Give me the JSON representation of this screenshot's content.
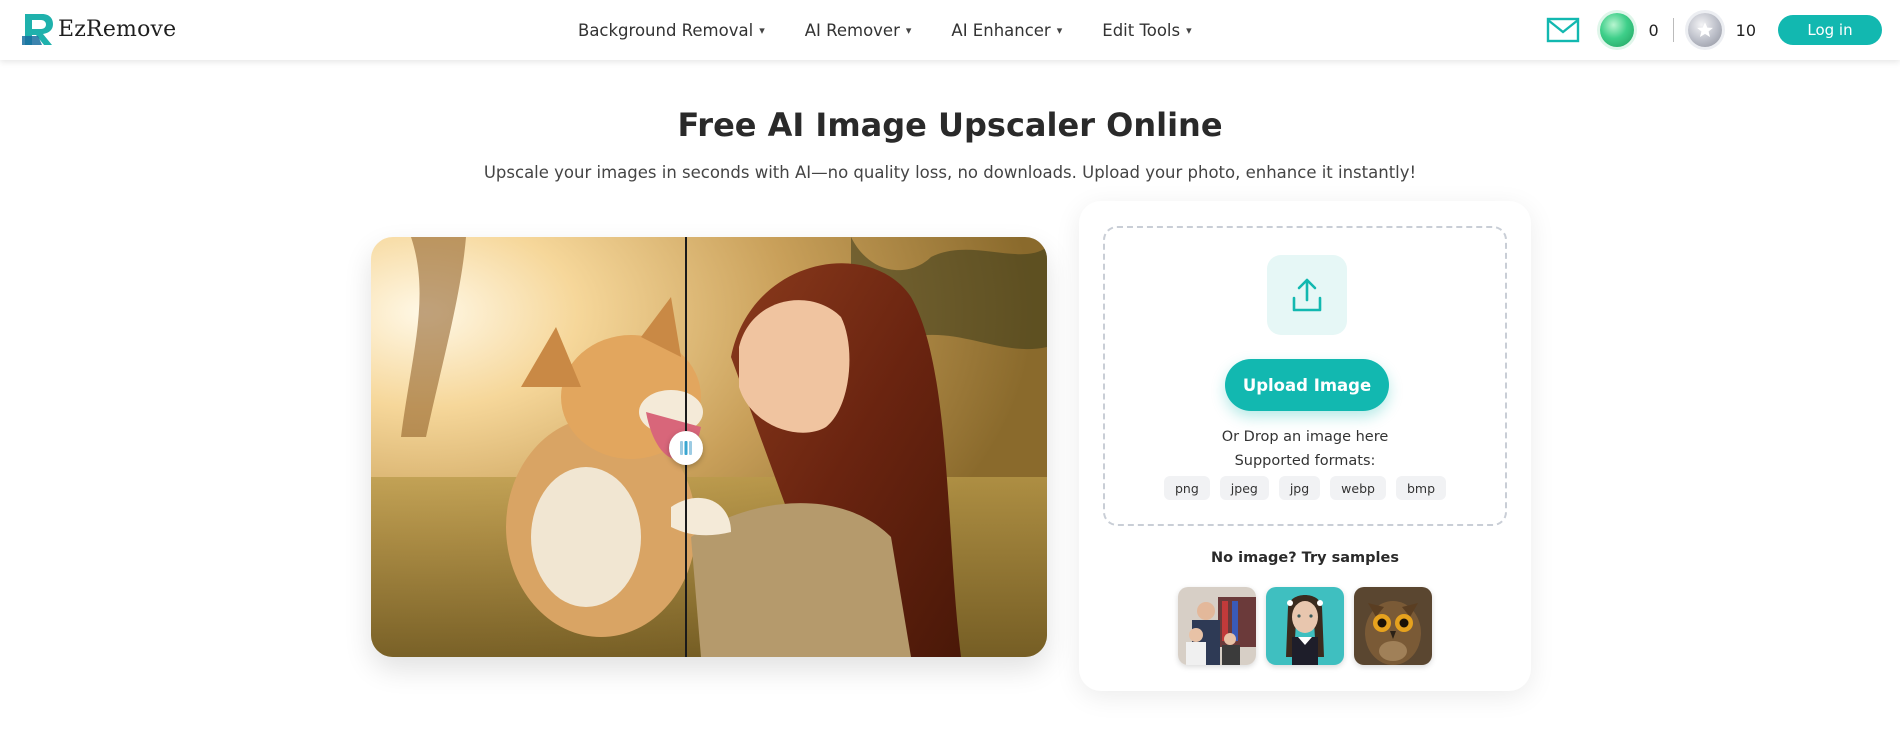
{
  "brand": {
    "name": "EzRemove"
  },
  "nav": {
    "items": [
      {
        "label": "Background Removal"
      },
      {
        "label": "AI Remover"
      },
      {
        "label": "AI Enhancer"
      },
      {
        "label": "Edit Tools"
      }
    ],
    "caret": "▾"
  },
  "account": {
    "green_credits": "0",
    "silver_credits": "10",
    "login_label": "Log in"
  },
  "hero": {
    "title": "Free AI Image Upscaler Online",
    "subtitle": "Upscale your images in seconds with AI—no quality loss, no downloads. Upload your photo, enhance it instantly!"
  },
  "upload": {
    "button_label": "Upload Image",
    "drop_text": "Or Drop an image here",
    "formats_label": "Supported formats:",
    "formats": [
      "png",
      "jpeg",
      "jpg",
      "webp",
      "bmp"
    ]
  },
  "samples": {
    "title": "No image? Try samples",
    "items": [
      {
        "name": "sample-family"
      },
      {
        "name": "sample-girl-braids"
      },
      {
        "name": "sample-owl"
      }
    ]
  },
  "colors": {
    "accent": "#12b8b0",
    "accent_light": "#e6f7f6"
  },
  "icons": [
    "mail-icon",
    "green-coin-icon",
    "silver-coin-icon",
    "upload-icon",
    "slider-handle-icon",
    "chevron-down-icon"
  ]
}
